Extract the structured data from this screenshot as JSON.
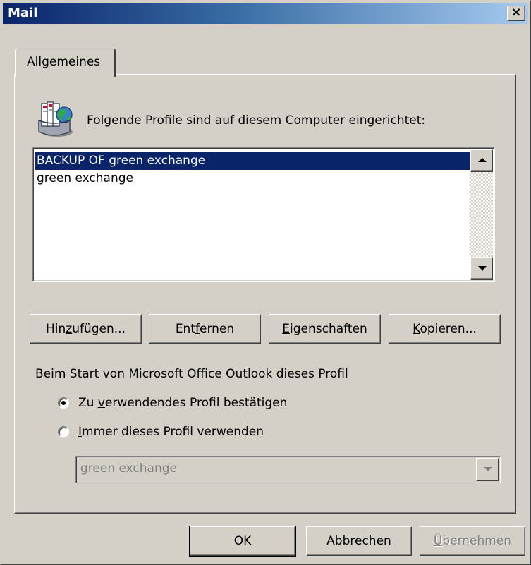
{
  "window": {
    "title": "Mail",
    "close_label": "×"
  },
  "tabs": [
    {
      "label": "Allgemeines",
      "active": true
    }
  ],
  "profiles_label": {
    "mnemonic": "F",
    "rest": "olgende Profile sind auf diesem Computer eingerichtet:"
  },
  "profiles": [
    {
      "name": "BACKUP OF green exchange",
      "selected": true
    },
    {
      "name": "green exchange",
      "selected": false
    }
  ],
  "buttons": {
    "add": {
      "pre": "Hin",
      "mn": "z",
      "post": "ufügen..."
    },
    "remove": {
      "pre": "Ent",
      "mn": "f",
      "post": "ernen"
    },
    "properties": {
      "pre": "",
      "mn": "E",
      "post": "igenschaften"
    },
    "copy": {
      "pre": "",
      "mn": "K",
      "post": "opieren..."
    }
  },
  "startup_label": "Beim Start von Microsoft Office Outlook dieses Profil",
  "options": {
    "prompt": {
      "pre": "Zu ",
      "mn": "v",
      "post": "erwendendes Profil bestätigen",
      "checked": true
    },
    "always": {
      "pre": "",
      "mn": "I",
      "post": "mmer dieses Profil verwenden",
      "checked": false
    }
  },
  "profile_select": {
    "value": "green exchange",
    "enabled": false
  },
  "dialog_buttons": {
    "ok": "OK",
    "cancel": "Abbrechen",
    "apply": {
      "pre": "",
      "mn": "Ü",
      "post": "bernehmen",
      "enabled": false
    }
  },
  "colors": {
    "selection": "#0a246a",
    "face": "#d4d0c8",
    "title_start": "#0a246a",
    "title_end": "#a6caf0"
  },
  "icons": {
    "profile": "mail-profile-globe-icon"
  }
}
